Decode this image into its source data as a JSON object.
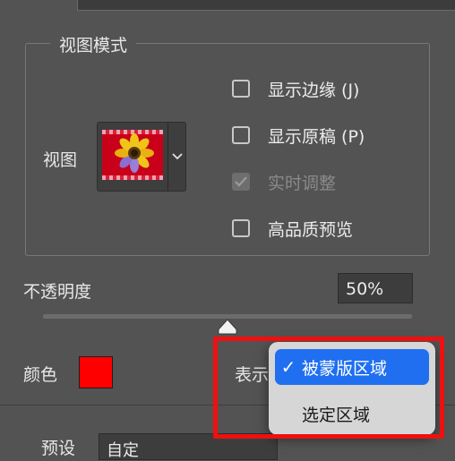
{
  "view_mode": {
    "title": "视图模式",
    "view_label": "视图",
    "checkboxes": [
      {
        "label": "显示边缘 (J)",
        "checked": false,
        "disabled": false
      },
      {
        "label": "显示原稿 (P)",
        "checked": false,
        "disabled": false
      },
      {
        "label": "实时调整",
        "checked": true,
        "disabled": true
      },
      {
        "label": "高品质预览",
        "checked": false,
        "disabled": false
      }
    ]
  },
  "opacity": {
    "label": "不透明度",
    "value": "50%",
    "level": 0.5
  },
  "color": {
    "label": "颜色",
    "swatch": "#ff0000"
  },
  "show": {
    "label": "表示",
    "options": [
      "被蒙版区域",
      "选定区域"
    ],
    "selected": "被蒙版区域"
  },
  "preset": {
    "label": "预设",
    "value": "自定"
  },
  "colors": {
    "accent": "#1f6ff0",
    "highlight": "#ee1010"
  }
}
